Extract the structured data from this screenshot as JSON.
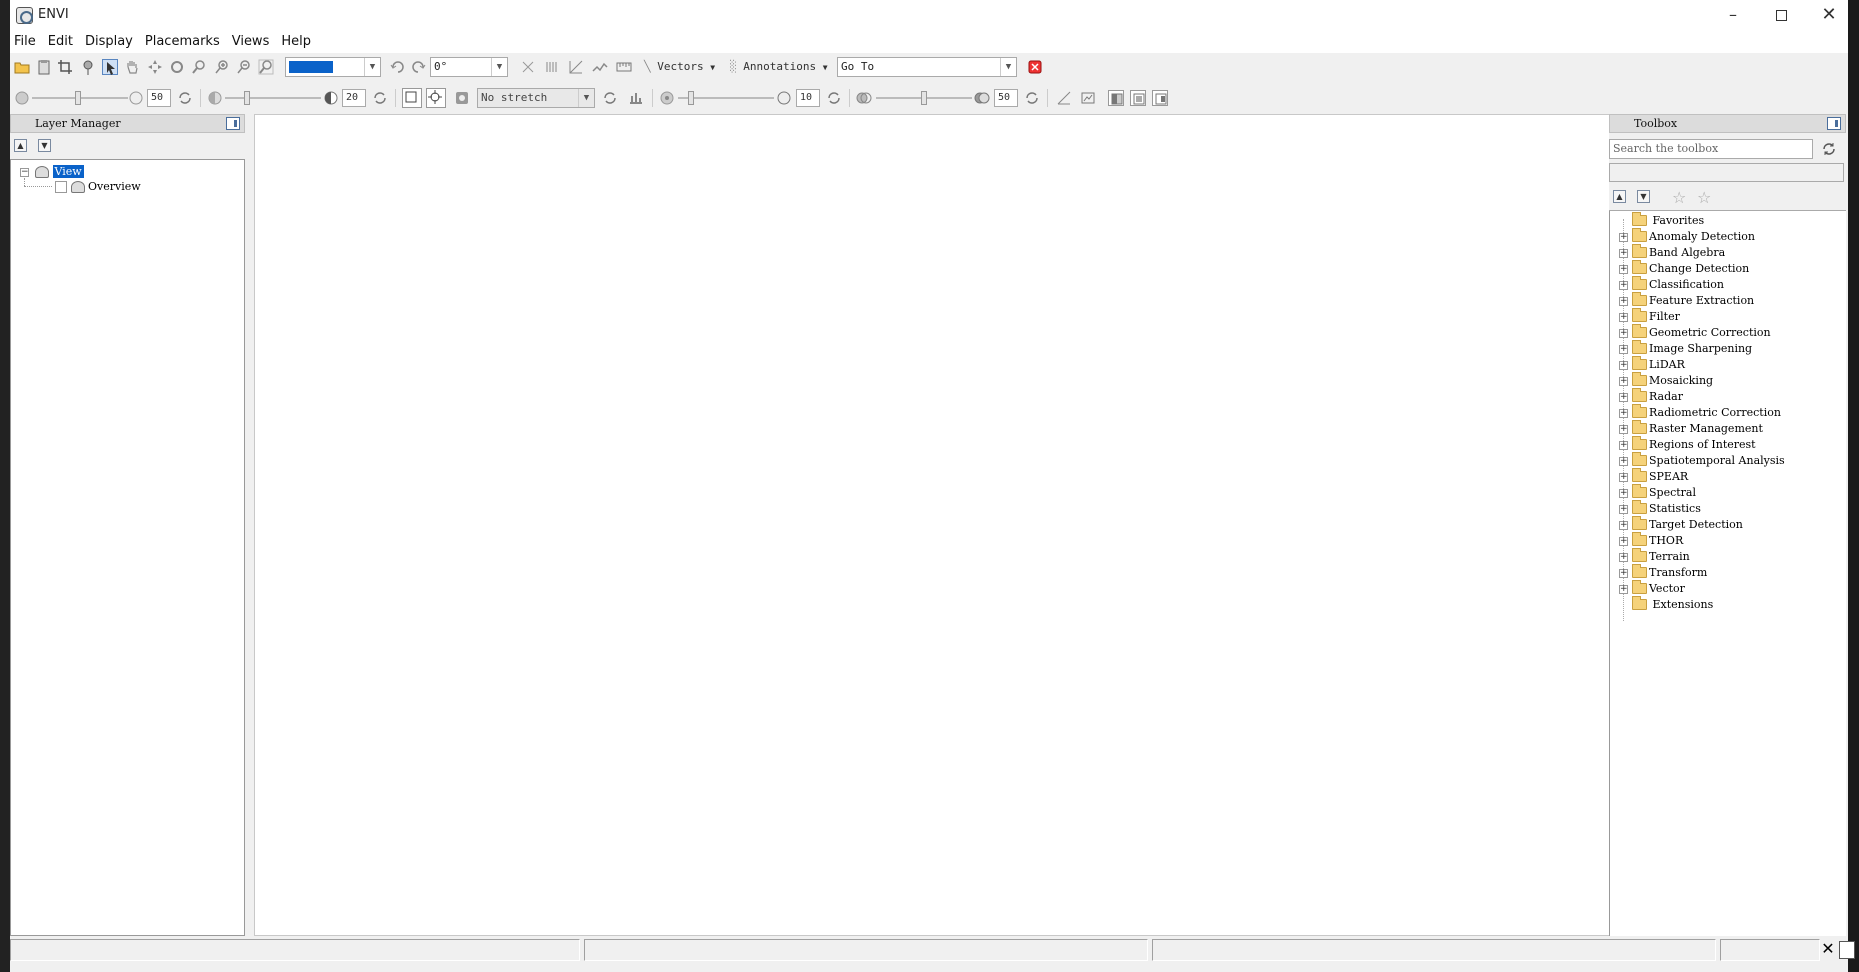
{
  "window": {
    "title": "ENVI"
  },
  "menu": [
    "File",
    "Edit",
    "Display",
    "Placemarks",
    "Views",
    "Help"
  ],
  "toolbar": {
    "rotation_value": "0°",
    "vectors_label": "Vectors",
    "annotations_label": "Annotations",
    "goto_placeholder": "Go To"
  },
  "toolbar2": {
    "brightness_value": "50",
    "contrast_value": "20",
    "stretch_value": "No stretch",
    "sharpen_value": "10",
    "transparency_value": "50"
  },
  "layer_manager": {
    "title": "Layer Manager",
    "items": [
      {
        "label": "View",
        "selected": true
      },
      {
        "label": "Overview",
        "selected": false
      }
    ]
  },
  "toolbox": {
    "title": "Toolbox",
    "search_placeholder": "Search the toolbox",
    "favorites": "Favorites",
    "categories": [
      "Anomaly Detection",
      "Band Algebra",
      "Change Detection",
      "Classification",
      "Feature Extraction",
      "Filter",
      "Geometric Correction",
      "Image Sharpening",
      "LiDAR",
      "Mosaicking",
      "Radar",
      "Radiometric Correction",
      "Raster Management",
      "Regions of Interest",
      "Spatiotemporal Analysis",
      "SPEAR",
      "Spectral",
      "Statistics",
      "Target Detection",
      "THOR",
      "Terrain",
      "Transform",
      "Vector"
    ],
    "extensions": "Extensions"
  },
  "colors": {
    "selection": "#0a62c9",
    "folder": "#f5d27a",
    "accent_icon": "#4a6e9c"
  }
}
